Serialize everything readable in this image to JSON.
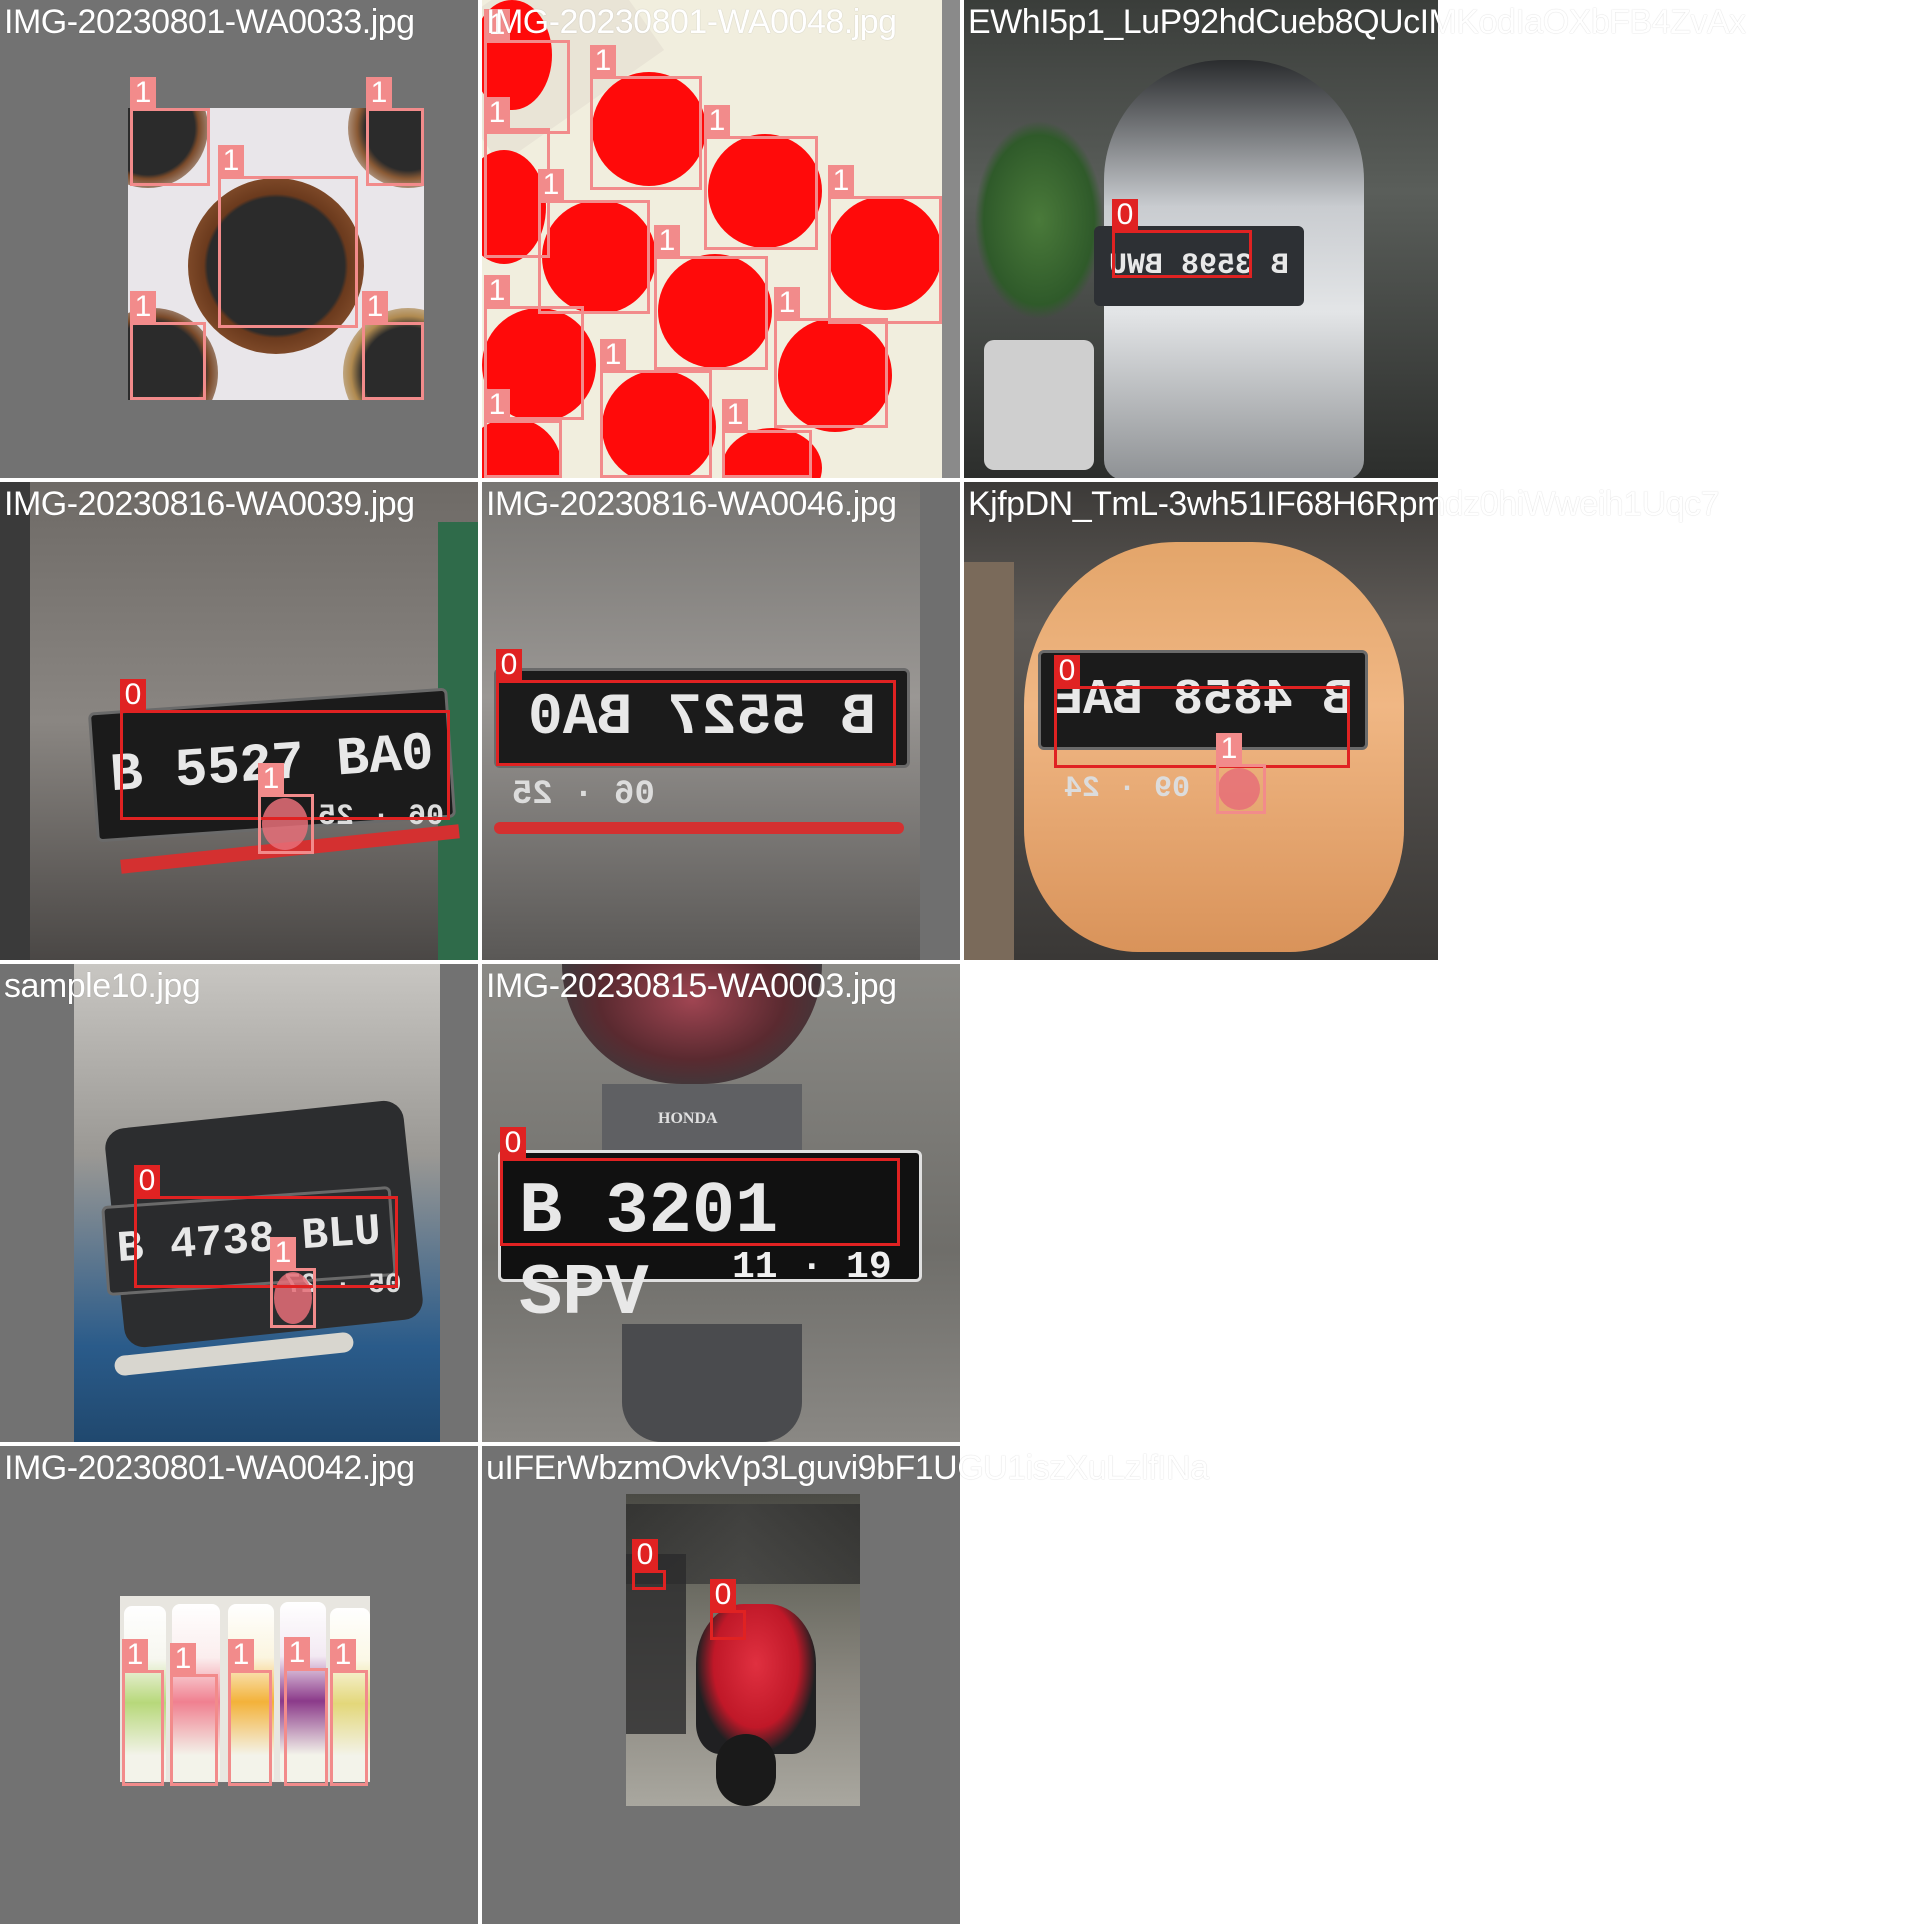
{
  "tiles": [
    {
      "title": "IMG-20230801-WA0033.jpg",
      "labels": [
        "1",
        "1",
        "1",
        "1",
        "1"
      ]
    },
    {
      "title": "IMG-20230801-WA0048.jpg",
      "labels": [
        "1",
        "1",
        "1",
        "1",
        "1",
        "1",
        "1",
        "1",
        "1",
        "1",
        "1",
        "1"
      ]
    },
    {
      "title": "EWhI5p1_LuP92hdCueb8QUcIMKodIaOXbFB4ZvAx",
      "labels": [
        "0"
      ],
      "plate": "B 3598 BWU"
    },
    {
      "title": "IMG-20230816-WA0039.jpg",
      "labels": [
        "0",
        "1"
      ],
      "plate": "B 5527 BA0",
      "plate_sub": "06 · 25"
    },
    {
      "title": "IMG-20230816-WA0046.jpg",
      "labels": [
        "0"
      ],
      "plate": "B 5527 BA0",
      "plate_sub": "06 · 25"
    },
    {
      "title": "KjfpDN_TmL-3wh51IF68H6Rpmdz0hiWweih1Uqc7",
      "labels": [
        "0",
        "1"
      ],
      "plate": "B 4858 BAE",
      "plate_sub": "09 · 24"
    },
    {
      "title": "sample10.jpg",
      "labels": [
        "0",
        "1"
      ],
      "plate": "B 4738 BLU",
      "plate_sub": "05 · 27"
    },
    {
      "title": "IMG-20230815-WA0003.jpg",
      "labels": [
        "0"
      ],
      "plate": "B 3201 SPV",
      "plate_sub": "11 · 19",
      "brand": "HONDA"
    },
    {
      "title": "IMG-20230801-WA0042.jpg",
      "labels": [
        "1",
        "1",
        "1",
        "1",
        "1"
      ]
    },
    {
      "title": "uIFErWbzmOvkVp3Lguvi9bF1UGU1iszXuLzlfINa",
      "labels": [
        "0",
        "0"
      ]
    }
  ],
  "colors": {
    "class0": "#e02222",
    "class1": "#f28b8b",
    "pad": "#727272"
  }
}
